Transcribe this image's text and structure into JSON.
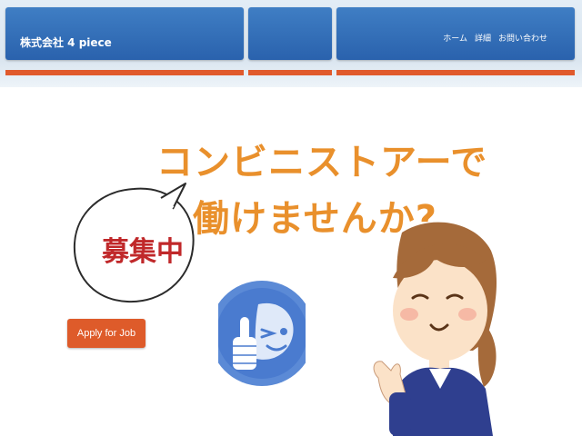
{
  "header": {
    "brand": "株式会社 4 piece",
    "nav": [
      "ホーム",
      "詳細",
      "お問い合わせ"
    ]
  },
  "hero": {
    "headline_line1": "コンビニストアーで",
    "headline_line2": "働けませんか?",
    "bubble_text": "募集中",
    "apply_button": "Apply for Job"
  },
  "colors": {
    "header_blue": "#2f6db8",
    "accent_orange": "#e05a2c",
    "headline_orange": "#e9902c",
    "bubble_red": "#c0282a",
    "logo_blue": "#5b8ad6"
  },
  "icons": {
    "logo": "thumbs-up-wink-logo",
    "illustration": "waving-woman-illustration"
  }
}
